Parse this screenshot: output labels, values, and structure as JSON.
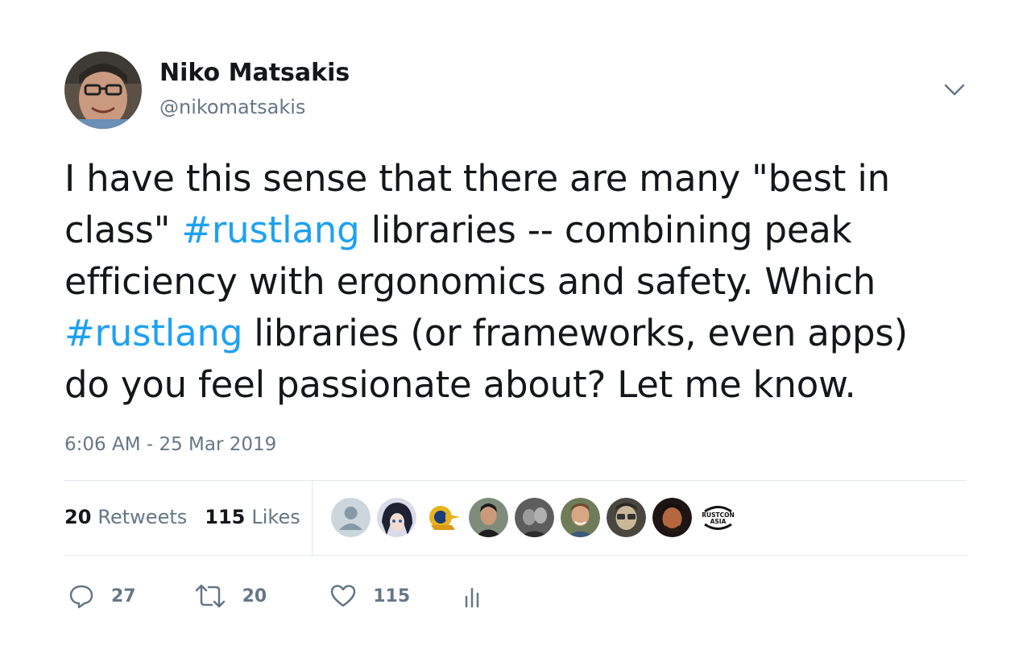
{
  "user": {
    "display_name": "Niko Matsakis",
    "handle": "@nikomatsakis"
  },
  "tweet": {
    "segments": [
      {
        "text": "I have this sense that there are many \"best in\nclass\" ",
        "type": "text"
      },
      {
        "text": "#rustlang",
        "type": "hashtag"
      },
      {
        "text": " libraries -- combining peak\nefficiency with ergonomics and safety. Which\n",
        "type": "text"
      },
      {
        "text": "#rustlang",
        "type": "hashtag"
      },
      {
        "text": " libraries (or frameworks, even apps)\ndo you feel passionate about? Let me know.",
        "type": "text"
      }
    ],
    "timestamp": "6:06 AM - 25 Mar 2019"
  },
  "stats": {
    "retweets_count": "20",
    "retweets_label": "Retweets",
    "likes_count": "115",
    "likes_label": "Likes"
  },
  "likers": [
    {
      "name": "default-avatar"
    },
    {
      "name": "anime-avatar"
    },
    {
      "name": "badge-avatar"
    },
    {
      "name": "person-avatar"
    },
    {
      "name": "person-avatar"
    },
    {
      "name": "person-avatar"
    },
    {
      "name": "person-avatar"
    },
    {
      "name": "person-avatar"
    },
    {
      "name": "rustcon-asia-logo",
      "text_line1": "RUSTCON",
      "text_line2": "ASIA"
    }
  ],
  "actions": {
    "reply_count": "27",
    "retweet_count": "20",
    "like_count": "115"
  },
  "colors": {
    "accent": "#1da1f2",
    "secondary_text": "#657786",
    "divider": "#e1e8ed"
  },
  "icons": [
    "caret-down-icon",
    "reply-icon",
    "retweet-icon",
    "heart-icon",
    "analytics-icon"
  ]
}
